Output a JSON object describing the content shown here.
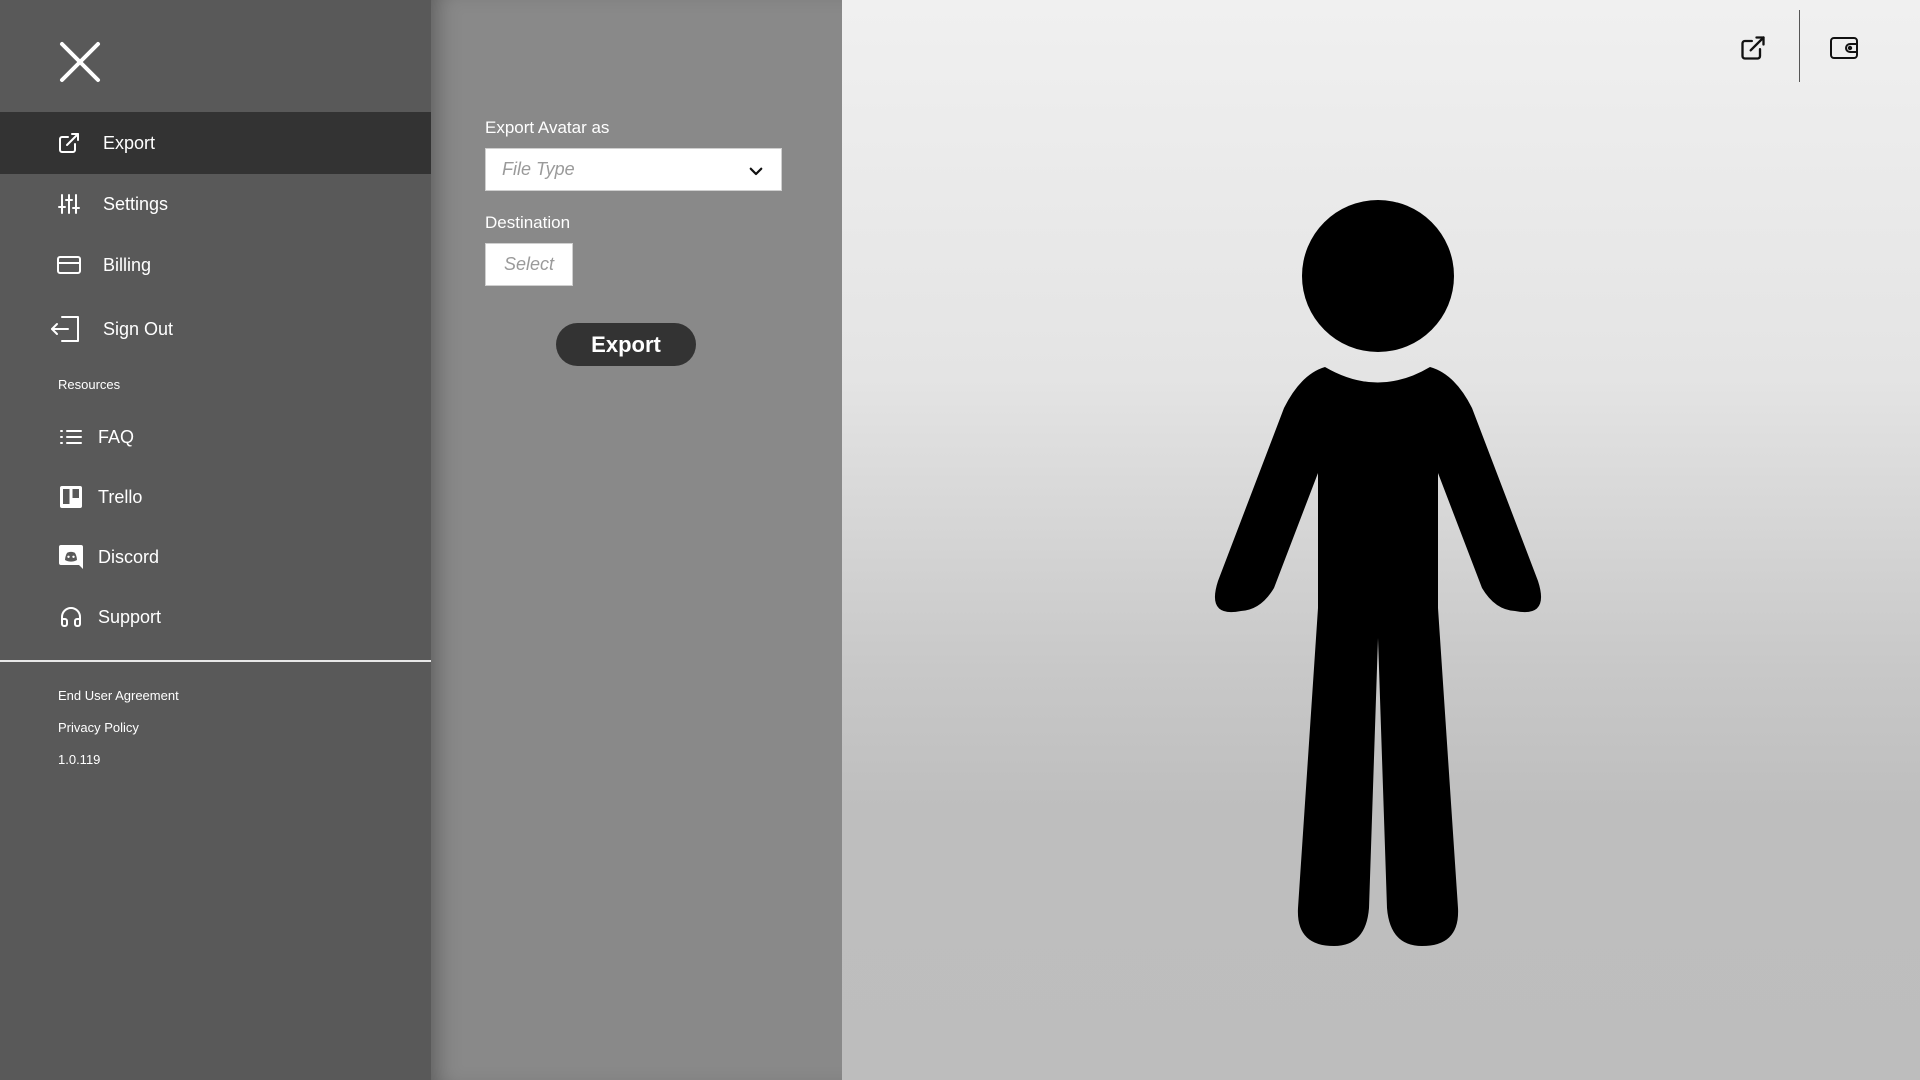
{
  "sidebar": {
    "nav": [
      {
        "label": "Export",
        "icon": "external-link-icon",
        "active": true
      },
      {
        "label": "Settings",
        "icon": "sliders-icon"
      },
      {
        "label": "Billing",
        "icon": "credit-card-icon"
      },
      {
        "label": "Sign Out",
        "icon": "sign-out-icon"
      }
    ],
    "resources_title": "Resources",
    "resources": [
      {
        "label": "FAQ",
        "icon": "list-icon"
      },
      {
        "label": "Trello",
        "icon": "trello-icon"
      },
      {
        "label": "Discord",
        "icon": "discord-icon"
      },
      {
        "label": "Support",
        "icon": "headphones-icon"
      }
    ],
    "footer": {
      "eula": "End User Agreement",
      "privacy": "Privacy Policy",
      "version": "1.0.119"
    }
  },
  "export_panel": {
    "file_type_label": "Export Avatar as",
    "file_type_placeholder": "File Type",
    "destination_label": "Destination",
    "destination_placeholder": "Select",
    "export_button": "Export"
  },
  "colors": {
    "sidebar_bg": "#595959",
    "active_item_bg": "#333333",
    "panel_bg": "#898989",
    "button_bg": "#333333"
  }
}
